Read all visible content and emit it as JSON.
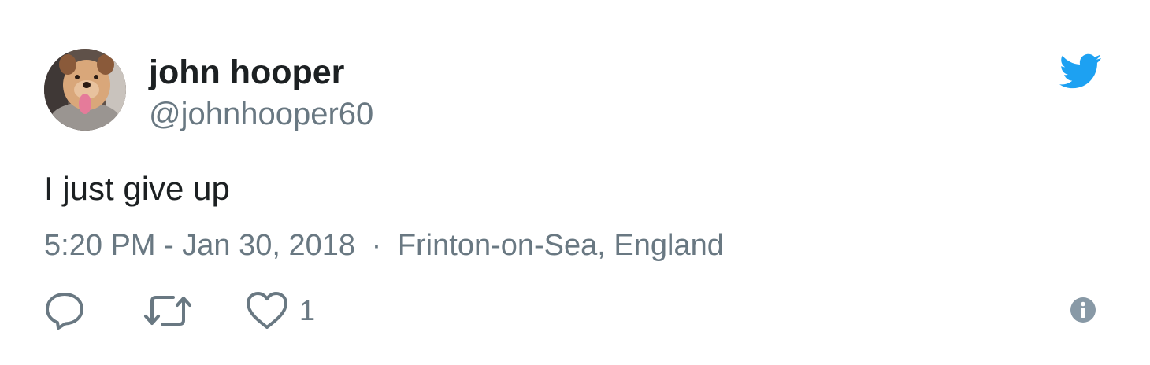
{
  "tweet": {
    "author": {
      "name": "john hooper",
      "handle": "@johnhooper60"
    },
    "text": "I just give up",
    "time": "5:20 PM - Jan 30, 2018",
    "separator": "·",
    "location": "Frinton-on-Sea, England",
    "actions": {
      "like_count": "1"
    }
  },
  "colors": {
    "twitter_blue": "#1da1f2",
    "secondary_text": "#697882",
    "primary_text": "#1c2022",
    "icon_gray": "#8899a6"
  },
  "icons": {
    "brand": "twitter-bird-icon",
    "reply": "reply-icon",
    "retweet": "retweet-icon",
    "like": "heart-icon",
    "info": "info-icon"
  }
}
